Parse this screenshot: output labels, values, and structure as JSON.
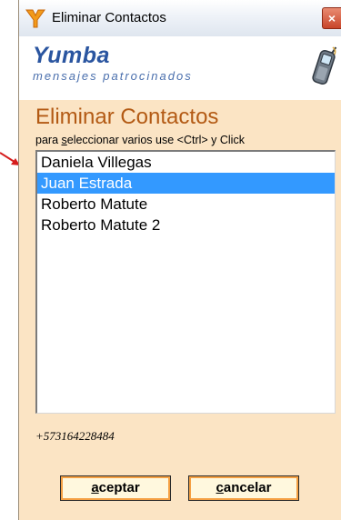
{
  "window": {
    "title": "Eliminar Contactos",
    "close_label": "×"
  },
  "brand": {
    "name": "Yumba",
    "tagline": "mensajes patrocinados"
  },
  "dialog": {
    "heading": "Eliminar Contactos",
    "hint_pre": "para ",
    "hint_underlined": "s",
    "hint_post": "eleccionar varios use <Ctrl> y Click"
  },
  "contacts": [
    {
      "name": "Daniela Villegas",
      "selected": false
    },
    {
      "name": "Juan Estrada",
      "selected": true
    },
    {
      "name": "Roberto Matute",
      "selected": false
    },
    {
      "name": "Roberto Matute 2",
      "selected": false
    }
  ],
  "selected_phone": "+573164228484",
  "buttons": {
    "ok_first": "a",
    "ok_rest": "ceptar",
    "cancel_first": "c",
    "cancel_rest": "ancelar"
  },
  "colors": {
    "accent": "#b35a14",
    "selection": "#3399ff",
    "background": "#fbe4c4",
    "brand": "#2a55a0",
    "arrow": "#d61c1c"
  },
  "icons": [
    "yumba-logo-icon",
    "close-icon",
    "mobile-phone-icon",
    "annotation-arrow-icon"
  ]
}
